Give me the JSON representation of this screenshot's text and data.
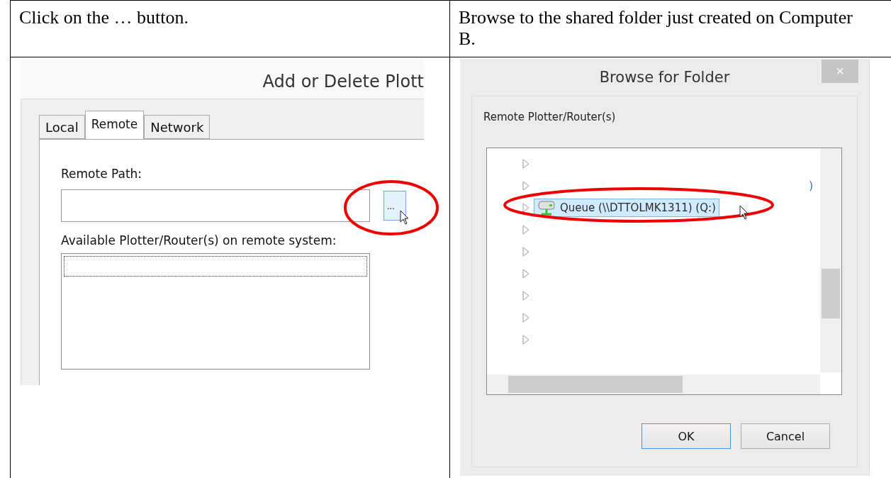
{
  "table": {
    "rows": [
      {
        "cells": [
          {
            "text": "Click on the … button."
          },
          {
            "text": "Browse to the shared folder just created on Computer B."
          }
        ]
      }
    ]
  },
  "left_screenshot": {
    "title": "Add or Delete Plott",
    "tabs": [
      {
        "label": "Local",
        "selected": false
      },
      {
        "label": "Remote",
        "selected": true
      },
      {
        "label": "Network",
        "selected": false
      }
    ],
    "path_label": "Remote Path:",
    "browse_button": "...",
    "highlighted": true,
    "list_label": "Available Plotter/Router(s) on remote system:"
  },
  "right_screenshot": {
    "title": "Browse for Folder",
    "close": "×",
    "label": "Remote Plotter/Router(s)",
    "tree": [
      {
        "selected": false
      },
      {
        "label": ")",
        "selected": false
      },
      {
        "label": "Queue (\\\\DTTOLMK1311) (Q:)",
        "selected": true
      },
      {
        "selected": false
      },
      {
        "selected": false
      },
      {
        "selected": false
      },
      {
        "selected": false
      },
      {
        "selected": false
      },
      {
        "selected": false
      }
    ],
    "buttons": [
      {
        "label": "OK",
        "default": true
      },
      {
        "label": "Cancel",
        "default": false
      }
    ]
  }
}
